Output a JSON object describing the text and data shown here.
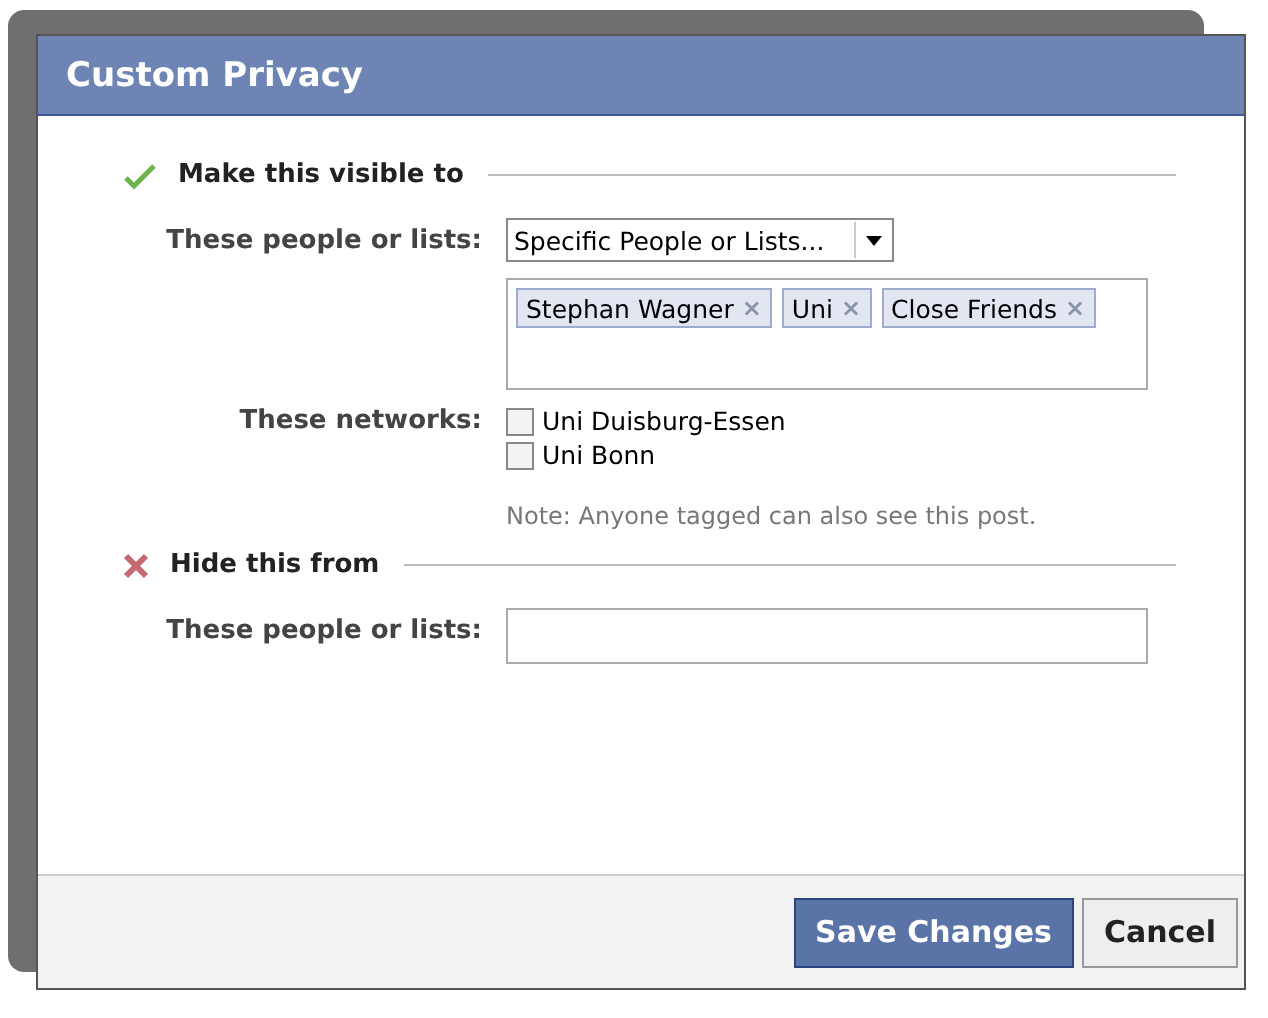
{
  "window": {
    "title": "Custom Privacy"
  },
  "sections": [
    {
      "kind": "allow",
      "heading": "Make this visible to",
      "people_label": "These people or lists:",
      "select": {
        "value": "Specific People or Lists..."
      },
      "tokens": [
        {
          "label": "Stephan Wagner",
          "remove": "×"
        },
        {
          "label": "Uni",
          "remove": "×"
        },
        {
          "label": "Close Friends",
          "remove": "×"
        }
      ],
      "networks_label": "These networks:",
      "networks": [
        {
          "label": "Uni Duisburg-Essen",
          "checked": false
        },
        {
          "label": "Uni Bonn",
          "checked": false
        }
      ],
      "note": "Note: Anyone tagged can also see this post."
    },
    {
      "kind": "deny",
      "heading": "Hide this from",
      "people_label": "These people or lists:"
    }
  ],
  "buttons": [
    {
      "label": "Save Changes",
      "kind": "primary"
    },
    {
      "label": "Cancel",
      "kind": "secondary"
    }
  ]
}
